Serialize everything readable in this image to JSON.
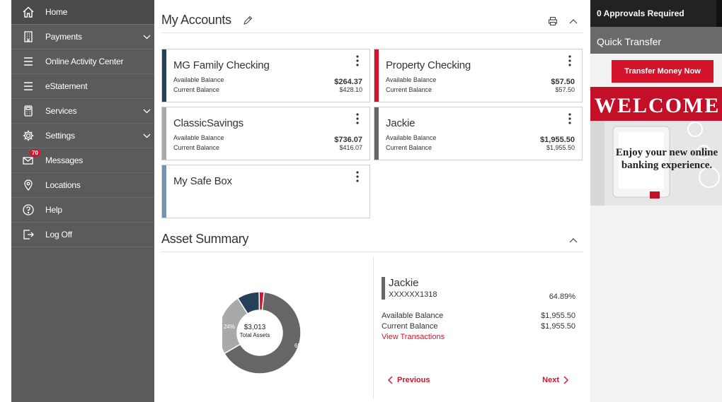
{
  "colors": {
    "sidebar": "#5b5b5b",
    "accent_red": "#d4142c",
    "navy": "#26405a",
    "gray": "#666666",
    "light_gray": "#a9a9a9",
    "steel_blue": "#7393b5"
  },
  "sidebar": {
    "items": [
      {
        "label": "Home",
        "icon": "home-icon"
      },
      {
        "label": "Payments",
        "icon": "building-icon",
        "expandable": true
      },
      {
        "label": "Online Activity Center",
        "icon": "menu-lines-icon"
      },
      {
        "label": "eStatement",
        "icon": "menu-lines-icon"
      },
      {
        "label": "Services",
        "icon": "calculator-icon",
        "expandable": true
      },
      {
        "label": "Settings",
        "icon": "gear-icon",
        "expandable": true
      },
      {
        "label": "Messages",
        "icon": "envelope-icon",
        "badge": "70"
      },
      {
        "label": "Locations",
        "icon": "map-pin-icon"
      },
      {
        "label": "Help",
        "icon": "help-icon"
      },
      {
        "label": "Log Off",
        "icon": "logout-icon"
      }
    ]
  },
  "my_accounts": {
    "title": "My Accounts",
    "accounts": [
      {
        "name": "MG Family Checking",
        "available_label": "Available Balance",
        "available": "$264.37",
        "current_label": "Current Balance",
        "current": "$428.10",
        "color": "#26405a"
      },
      {
        "name": "Property Checking",
        "available_label": "Available Balance",
        "available": "$57.50",
        "current_label": "Current Balance",
        "current": "$57.50",
        "color": "#d4142c"
      },
      {
        "name": "ClassicSavings",
        "available_label": "Available Balance",
        "available": "$736.07",
        "current_label": "Current Balance",
        "current": "$416.07",
        "color": "#a9a9a9"
      },
      {
        "name": "Jackie",
        "available_label": "Available Balance",
        "available": "$1,955.50",
        "current_label": "Current Balance",
        "current": "$1,955.50",
        "color": "#666666"
      },
      {
        "name": "My Safe Box",
        "color": "#7393b5"
      }
    ]
  },
  "asset_summary": {
    "title": "Asset Summary",
    "total_value": "$3,013",
    "total_label": "Total Assets",
    "segments": [
      {
        "name": "Jackie",
        "percent": 64.89,
        "label": "65%",
        "color": "#666666"
      },
      {
        "name": "ClassicSavings",
        "percent": 24.43,
        "label": "24%",
        "color": "#a9a9a9"
      },
      {
        "name": "MG Family Checking",
        "percent": 8.77,
        "label": "",
        "color": "#26405a"
      },
      {
        "name": "Property Checking",
        "percent": 1.91,
        "label": "",
        "color": "#d4142c"
      }
    ],
    "detail": {
      "name": "Jackie",
      "number": "XXXXXX1318",
      "percent": "64.89%",
      "available_label": "Available Balance",
      "available": "$1,955.50",
      "current_label": "Current Balance",
      "current": "$1,955.50",
      "link": "View Transactions",
      "previous": "Previous",
      "next": "Next"
    }
  },
  "right_panel": {
    "approvals": "0 Approvals Required",
    "quick_transfer": "Quick Transfer",
    "transfer_button": "Transfer Money Now",
    "banner_title": "WELCOME",
    "banner_tagline_1": "Enjoy your new online",
    "banner_tagline_2": "banking experience."
  }
}
